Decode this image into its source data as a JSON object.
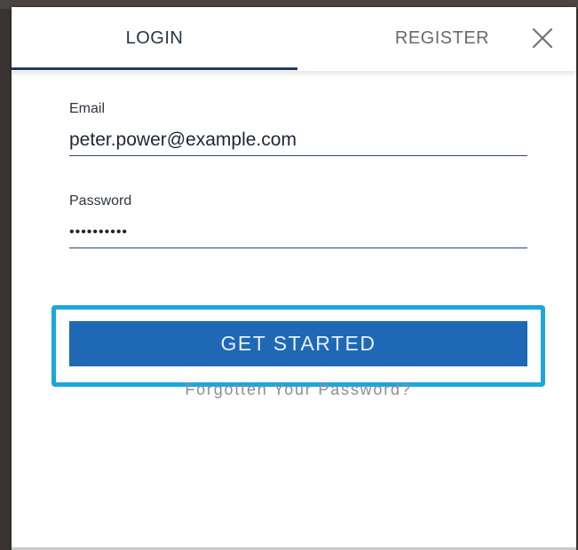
{
  "tabs": {
    "login_label": "LOGIN",
    "register_label": "REGISTER",
    "active": "LOGIN"
  },
  "close": {
    "icon": "close-icon"
  },
  "form": {
    "email_label": "Email",
    "email_value": "peter.power@example.com",
    "password_label": "Password",
    "password_value": "••••••••••"
  },
  "actions": {
    "submit_label": "GET STARTED",
    "forgot_label": "Forgotten Your Password?"
  },
  "colors": {
    "accent": "#1e68b6",
    "highlight": "#1ba7dc",
    "tab_underline": "#1f3a5f"
  }
}
